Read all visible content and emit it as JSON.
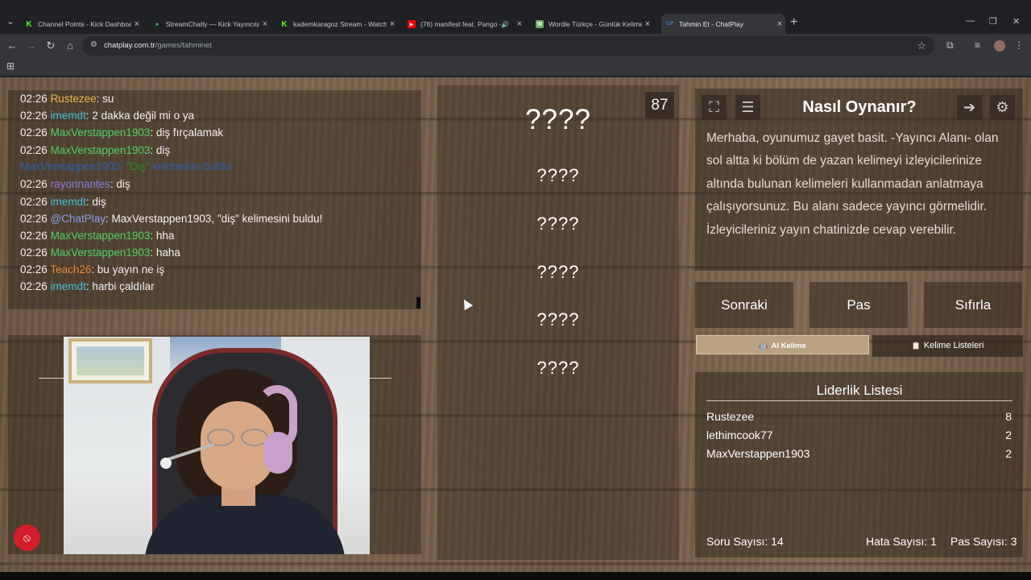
{
  "browser": {
    "tabs": [
      {
        "label": "Channel Points - Kick Dashboard",
        "favicon": "kick-icon",
        "color": "#53fc18"
      },
      {
        "label": "StreamChatly — Kick Yayıncıları",
        "favicon": "streamchatly-icon",
        "color": "#3ccf4e"
      },
      {
        "label": "kademkaragoz Stream - Watch",
        "favicon": "kick-icon",
        "color": "#53fc18"
      },
      {
        "label": "(76) manifest feat. Pango -",
        "favicon": "youtube-icon",
        "color": "#ff0000"
      },
      {
        "label": "Wordle Türkçe - Günlük Kelime",
        "favicon": "wordle-icon",
        "color": "#6aaa64"
      },
      {
        "label": "Tahmin Et - ChatPlay",
        "favicon": "chatplay-icon",
        "color": "#4a7bd0",
        "favicon_text": "CP",
        "active": true
      }
    ],
    "url_host": "chatplay.com.tr",
    "url_path": "/games/tahminet"
  },
  "chat": {
    "messages": [
      {
        "time": "02:26",
        "user": "Rustezee",
        "color": "#e3b34a",
        "text": ": su"
      },
      {
        "time": "02:26",
        "user": "imemdt",
        "color": "#3fc1d8",
        "text": ": 2 dakka değil mi o ya"
      },
      {
        "time": "02:26",
        "user": "MaxVerstappen1903",
        "color": "#4fd16b",
        "text": ": diş fırçalamak"
      },
      {
        "time": "02:26",
        "user": "MaxVerstappen1903",
        "color": "#4fd16b",
        "text": ": diş"
      },
      {
        "time": "02:26",
        "user": "rayonnantes",
        "color": "#8a7be0",
        "text": ": diş"
      },
      {
        "time": "02:26",
        "user": "imemdt",
        "color": "#3fc1d8",
        "text": ": diş"
      },
      {
        "time": "02:26",
        "user": "@ChatPlay",
        "color": "#8aa0e8",
        "text": ": MaxVerstappen1903, \"diş\" kelimesini buldu!"
      },
      {
        "time": "02:26",
        "user": "MaxVerstappen1903",
        "color": "#4fd16b",
        "text": ": hha"
      },
      {
        "time": "02:26",
        "user": "MaxVerstappen1903",
        "color": "#4fd16b",
        "text": ": haha"
      },
      {
        "time": "02:26",
        "user": "Teach26",
        "color": "#e88a3a",
        "text": ": bu yayın ne iş"
      },
      {
        "time": "02:26",
        "user": "imemdt",
        "color": "#3fc1d8",
        "text": ": harbi çaldılar"
      }
    ],
    "system": {
      "before": "MaxVerstappen1903, ",
      "word": "\"Diş\"",
      "after": " kelimesini buldu!"
    }
  },
  "game": {
    "timer": "87",
    "main_word": "????",
    "words": [
      "????",
      "????",
      "????",
      "????",
      "????"
    ]
  },
  "howto": {
    "title": "Nasıl Oynanır?",
    "text": "Merhaba, oyunumuz gayet basit. -Yayıncı Alanı- olan sol altta ki bölüm de yazan kelimeyi izleyicilerinize altında bulunan kelimeleri kullanmadan anlatmaya çalışıyorsunuz. Bu alanı sadece yayıncı görmelidir. İzleyicileriniz yayın chatinizde cevap verebilir."
  },
  "buttons": {
    "next": "Sonraki",
    "pass": "Pas",
    "reset": "Sıfırla"
  },
  "tabs": {
    "ai": "AI Kelime",
    "lists": "Kelime Listeleri"
  },
  "leaderboard": {
    "title": "Liderlik Listesi",
    "rows": [
      {
        "name": "Rustezee",
        "score": "8"
      },
      {
        "name": "lethimcook77",
        "score": "2"
      },
      {
        "name": "MaxVerstappen1903",
        "score": "2"
      }
    ]
  },
  "stats": {
    "questions": "Soru Sayısı: 14",
    "errors": "Hata Sayısı: 1",
    "passes": "Pas Sayısı: 3"
  }
}
